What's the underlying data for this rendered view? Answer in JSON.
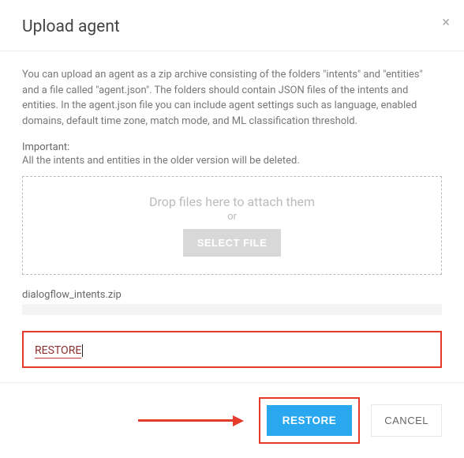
{
  "header": {
    "title": "Upload agent"
  },
  "body": {
    "description": "You can upload an agent as a zip archive consisting of the folders \"intents\" and \"entities\" and a file called \"agent.json\". The folders should contain JSON files of the intents and entities. In the agent.json file you can include agent settings such as language, enabled domains, default time zone, match mode, and ML classification threshold.",
    "important_label": "Important:",
    "important_text": "All the intents and entities in the older version will be deleted.",
    "dropzone": {
      "drop_text": "Drop files here to attach them",
      "or_text": "or",
      "select_label": "SELECT FILE"
    },
    "filename": "dialogflow_intents.zip",
    "confirm_value": "RESTORE"
  },
  "footer": {
    "restore_label": "RESTORE",
    "cancel_label": "CANCEL"
  }
}
